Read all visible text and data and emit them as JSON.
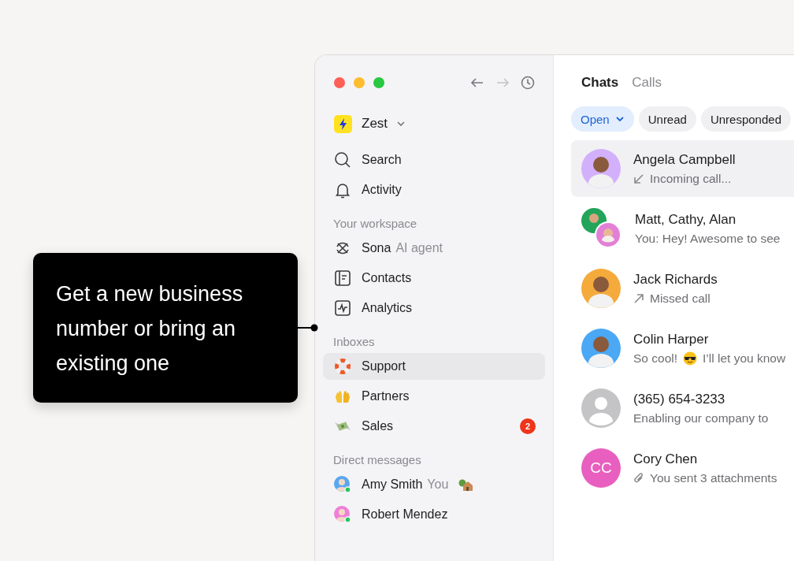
{
  "callout": {
    "text": "Get a new business number or bring an existing one"
  },
  "window": {
    "nav": {
      "back_disabled": false,
      "forward_disabled": true
    }
  },
  "sidebar": {
    "workspace": "Zest",
    "items": [
      {
        "label": "Search"
      },
      {
        "label": "Activity"
      }
    ],
    "sections": [
      {
        "title": "Your workspace",
        "items": [
          {
            "label": "Sona",
            "suffix": "AI agent",
            "selected": false
          },
          {
            "label": "Contacts",
            "selected": false
          },
          {
            "label": "Analytics",
            "selected": false
          }
        ]
      },
      {
        "title": "Inboxes",
        "items": [
          {
            "label": "Support",
            "selected": true
          },
          {
            "label": "Partners",
            "selected": false
          },
          {
            "label": "Sales",
            "badge": "2",
            "selected": false
          }
        ]
      },
      {
        "title": "Direct messages",
        "items": [
          {
            "label": "Amy Smith",
            "suffix": "You",
            "color": "#5aa7ef",
            "online": true,
            "selected": false
          },
          {
            "label": "Robert Mendez",
            "color": "#ef7fd9",
            "online": true,
            "selected": false
          }
        ]
      }
    ]
  },
  "main": {
    "tabs": [
      {
        "label": "Chats",
        "selected": true
      },
      {
        "label": "Calls",
        "selected": false
      }
    ],
    "filters": [
      {
        "label": "Open",
        "selected": true,
        "dropdown": true
      },
      {
        "label": "Unread",
        "selected": false
      },
      {
        "label": "Unresponded",
        "selected": false
      }
    ],
    "chats": [
      {
        "name": "Angela Campbell",
        "preview": {
          "kind": "incoming",
          "text": "Incoming call..."
        },
        "avatar": {
          "kind": "photo",
          "color": "#d3b0fb"
        },
        "selected": true
      },
      {
        "name": "Matt, Cathy, Alan",
        "preview": {
          "kind": "plain",
          "text": "You: Hey! Awesome to see"
        },
        "avatar": {
          "kind": "group",
          "color": "#22a45a"
        },
        "selected": false
      },
      {
        "name": "Jack Richards",
        "preview": {
          "kind": "outgoing",
          "text": "Missed call"
        },
        "avatar": {
          "kind": "photo",
          "color": "#f5aa3c"
        },
        "selected": false
      },
      {
        "name": "Colin Harper",
        "preview": {
          "kind": "emoji",
          "text": "So cool!",
          "text_after": "I’ll let you know"
        },
        "avatar": {
          "kind": "photo",
          "color": "#4aa8f5"
        },
        "selected": false
      },
      {
        "name": "(365) 654-3233",
        "preview": {
          "kind": "plain",
          "text": "Enabling our company to"
        },
        "avatar": {
          "kind": "placeholder",
          "color": "#c4c4c6"
        },
        "selected": false
      },
      {
        "name": "Cory Chen",
        "preview": {
          "kind": "attachment",
          "text": "You sent 3 attachments"
        },
        "avatar": {
          "kind": "initials",
          "initials": "CC",
          "color": "#e85fbf"
        },
        "selected": false
      }
    ]
  }
}
